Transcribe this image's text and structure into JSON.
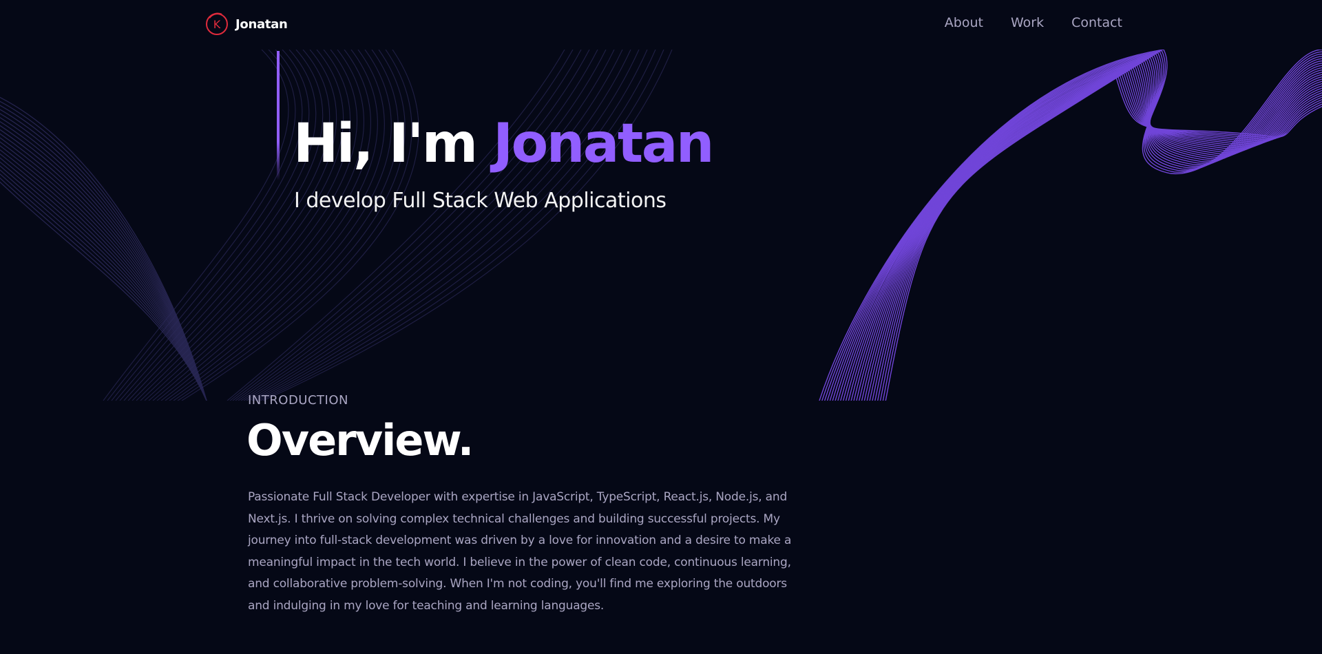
{
  "navbar": {
    "brand_name": "Jonatan",
    "logo_letter": "K",
    "links": [
      {
        "label": "About"
      },
      {
        "label": "Work"
      },
      {
        "label": "Contact"
      }
    ]
  },
  "hero": {
    "title_prefix": "Hi, I'm ",
    "title_name": "Jonatan",
    "subtitle": "I develop Full Stack Web Applications"
  },
  "overview": {
    "kicker": "INTRODUCTION",
    "title": "Overview.",
    "body": "Passionate Full Stack Developer with expertise in JavaScript, TypeScript, React.js, Node.js, and Next.js. I thrive on solving complex technical challenges and building successful projects. My journey into full-stack development was driven by a love for innovation and a desire to make a meaningful impact in the tech world. I believe in the power of clean code, continuous learning, and collaborative problem-solving. When I'm not coding, you'll find me exploring the outdoors and indulging in my love for teaching and learning languages."
  },
  "colors": {
    "background": "#050816",
    "accent": "#915eff",
    "secondary_text": "#aaa6c3",
    "logo_red": "#e02b3c"
  },
  "icons": {
    "brand_logo": "k-circle-logo-icon"
  }
}
